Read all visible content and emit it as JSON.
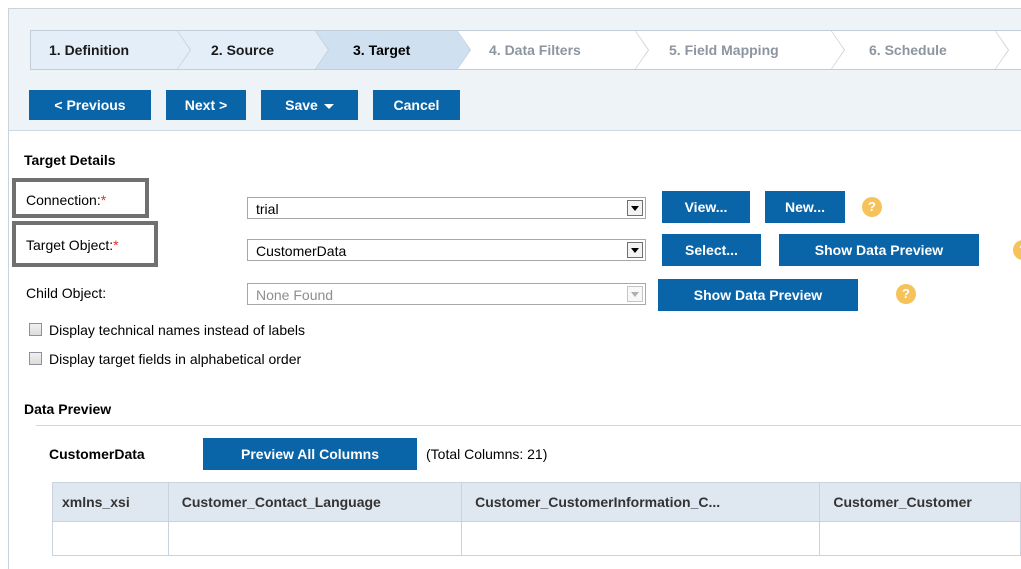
{
  "wizard": {
    "steps": [
      {
        "label": "1. Definition",
        "state": "done"
      },
      {
        "label": "2. Source",
        "state": "done"
      },
      {
        "label": "3. Target",
        "state": "current"
      },
      {
        "label": "4. Data Filters",
        "state": "todo"
      },
      {
        "label": "5. Field Mapping",
        "state": "todo"
      },
      {
        "label": "6. Schedule",
        "state": "todo"
      }
    ]
  },
  "toolbar": {
    "previous_label": "< Previous",
    "next_label": "Next >",
    "save_label": "Save",
    "cancel_label": "Cancel"
  },
  "target_details": {
    "title": "Target Details",
    "connection": {
      "label": "Connection:",
      "required": "*",
      "value": "trial",
      "view_label": "View...",
      "new_label": "New..."
    },
    "target_object": {
      "label": "Target Object:",
      "required": "*",
      "value": "CustomerData",
      "select_label": "Select...",
      "preview_label": "Show Data Preview"
    },
    "child_object": {
      "label": "Child Object:",
      "value": "None Found",
      "preview_label": "Show Data Preview"
    },
    "help_glyph": "?",
    "options": [
      {
        "label": "Display technical names instead of labels",
        "checked": false
      },
      {
        "label": "Display target fields in alphabetical order",
        "checked": false
      }
    ]
  },
  "data_preview": {
    "title": "Data Preview",
    "object_name": "CustomerData",
    "preview_all_label": "Preview All Columns",
    "total_columns": "(Total Columns: 21)",
    "columns": [
      "xmlns_xsi",
      "Customer_Contact_Language",
      "Customer_CustomerInformation_C...",
      "Customer_Customer"
    ]
  },
  "colors": {
    "button_blue": "#0a64a8",
    "required_red": "#d8322c",
    "help_orange": "#f6c35a",
    "header_bg": "#eef3f8"
  },
  "icons": {
    "help": "help-icon",
    "dropdown": "chevron-down-icon",
    "save_menu": "caret-down-icon"
  }
}
